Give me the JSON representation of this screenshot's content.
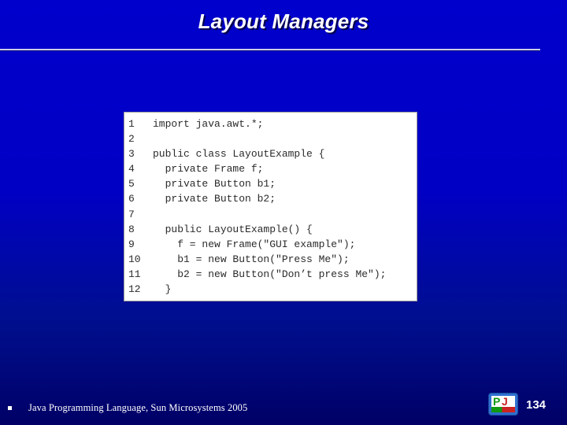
{
  "slide": {
    "title": "Layout Managers",
    "background_top_color": "#0000cc",
    "background_bottom_color": "#000066",
    "rule_color": "#c9ccea"
  },
  "code_figure": {
    "background_color": "#ffffff",
    "text_color": "#2b2b2b",
    "lines": [
      {
        "number": "1",
        "text": "import java.awt.*;"
      },
      {
        "number": "2",
        "text": ""
      },
      {
        "number": "3",
        "text": "public class LayoutExample {"
      },
      {
        "number": "4",
        "text": "  private Frame f;"
      },
      {
        "number": "5",
        "text": "  private Button b1;"
      },
      {
        "number": "6",
        "text": "  private Button b2;"
      },
      {
        "number": "7",
        "text": ""
      },
      {
        "number": "8",
        "text": "  public LayoutExample() {"
      },
      {
        "number": "9",
        "text": "    f = new Frame(\"GUI example\");"
      },
      {
        "number": "10",
        "text": "    b1 = new Button(\"Press Me\");"
      },
      {
        "number": "11",
        "text": "    b2 = new Button(\"Don’t press Me\");"
      },
      {
        "number": "12",
        "text": "  }"
      }
    ]
  },
  "footer": {
    "bullet": "square-bullet",
    "text": "Java Programming Language, Sun Microsystems 2005",
    "page_number": "134",
    "logo": {
      "name": "pj-logo",
      "letter_green": "P",
      "letter_red": "J",
      "green": "#119911",
      "red": "#cc2222",
      "frame_color": "#2f6fd0"
    }
  }
}
